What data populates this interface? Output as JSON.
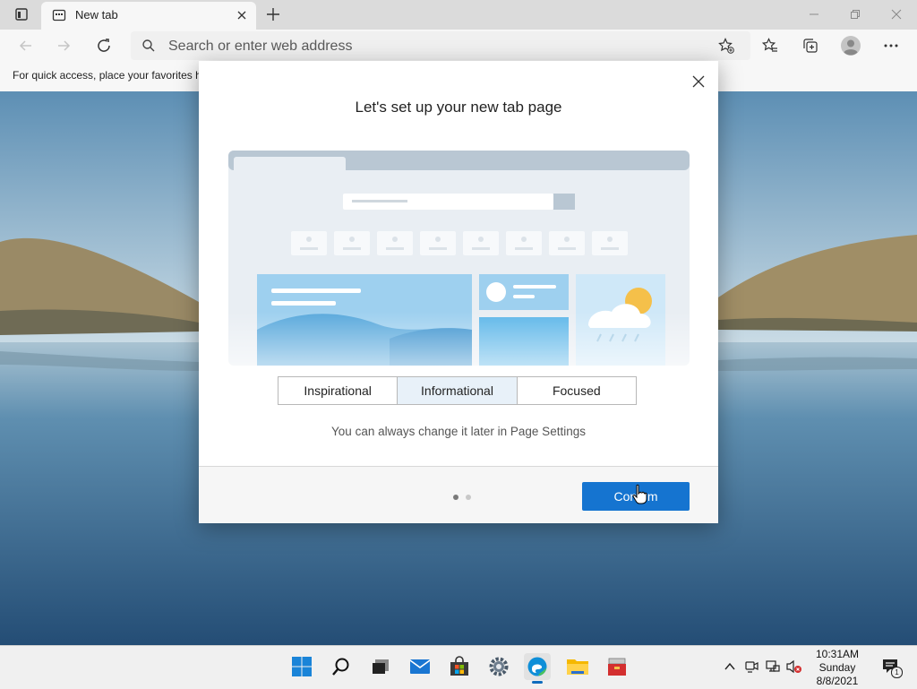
{
  "browser": {
    "tab_title": "New tab",
    "address_placeholder": "Search or enter web address",
    "favorites_hint": "For quick access, place your favorites h"
  },
  "dialog": {
    "title": "Let's set up your new tab page",
    "layout_options": [
      {
        "label": "Inspirational",
        "selected": false
      },
      {
        "label": "Informational",
        "selected": true
      },
      {
        "label": "Focused",
        "selected": false
      }
    ],
    "note": "You can always change it later in Page Settings",
    "confirm_label": "Confirm",
    "page_indicator": {
      "current": 1,
      "total": 2
    }
  },
  "taskbar": {
    "time": "10:31AM",
    "day": "Sunday",
    "date": "8/8/2021",
    "notification_count": "1"
  },
  "icons": [
    "tab-actions-icon",
    "new-tab-page-icon",
    "close-tab-icon",
    "new-tab-icon",
    "minimize-icon",
    "restore-icon",
    "window-close-icon",
    "back-icon",
    "forward-icon",
    "refresh-icon",
    "search-icon",
    "add-favorite-icon",
    "favorites-icon",
    "collections-icon",
    "profile-icon",
    "more-icon",
    "dialog-close-icon",
    "start-icon",
    "search-taskbar-icon",
    "task-view-icon",
    "mail-icon",
    "store-icon",
    "settings-icon",
    "edge-icon",
    "file-explorer-icon",
    "toolbox-icon",
    "chevron-up-icon",
    "meet-now-icon",
    "network-icon",
    "volume-muted-icon",
    "notification-icon"
  ],
  "colors": {
    "accent": "#1574d0",
    "selected_option": "#e8f1f9"
  }
}
